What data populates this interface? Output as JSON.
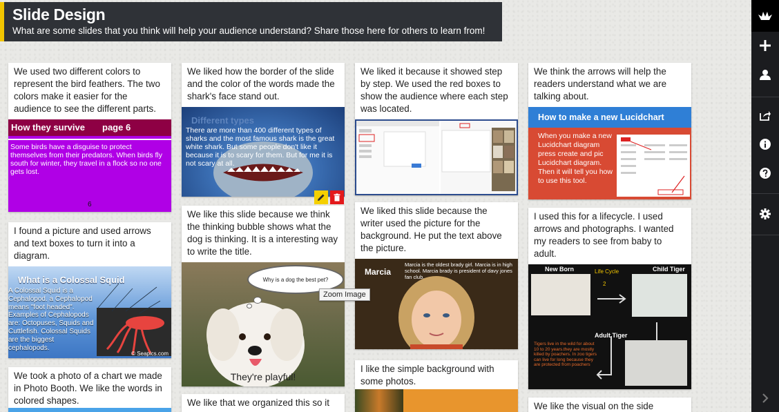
{
  "header": {
    "title": "Slide Design",
    "subtitle": "What are some slides that you think will help your audience understand? Share those here for others to learn from!"
  },
  "sidebar": {
    "icons": [
      "logo-bird-icon",
      "plus-icon",
      "user-icon",
      "share-icon",
      "info-icon",
      "help-icon",
      "gear-icon",
      "chevron-right-icon"
    ]
  },
  "tooltip": "Zoom Image",
  "colors": {
    "accent": "#f2c500",
    "header_bg": "#2f3237",
    "sidebar_bg": "#1b1c1f",
    "edit": "#f5d000",
    "delete": "#e3191b"
  },
  "cards": {
    "c1": {
      "text": "We used two different colors to represent the bird feathers. The two colors make it easier for the audience to see the different parts.",
      "slide_heading": "How they survive",
      "slide_page": "page 6",
      "slide_body": "Some birds have a disguise to protect themselves from their predators.  When birds fly south for winter, they travel in a flock so no one gets lost.",
      "slide_num": "6"
    },
    "c2": {
      "text": "I found a picture and used arrows and text boxes to turn it into a diagram.",
      "slide_heading": "What is a Colossal Squid",
      "slide_body": "A Colossal Squid is a Cephalopod. a Cephalopod means \"foot headed\". Examples of Cephalopods are: Octopuses, Squids and Cuttlefish. Colossal Squids are the biggest cephalopods.",
      "slide_credit": "© Seapics.com"
    },
    "c3": {
      "text": "We took a photo of a chart we made in Photo Booth.  We like the words in colored shapes."
    },
    "c4": {
      "text": "We liked how the border of the slide and the color of the words made the shark's face stand out.",
      "slide_heading": "Different types",
      "slide_body": "There are more than  400 different types of sharks and the most famous shark is the great white shark. But some people don't like it because it is to scary for them. But for me it is not scary at all."
    },
    "c5": {
      "text": "We like this slide because we think the thinking bubble shows what the dog is thinking. It is a interesting way to write the title.",
      "slide_bubble": "Why is a dog the best pet?",
      "slide_caption": "They're playful!"
    },
    "c6": {
      "text": "We like that we organized this so it"
    },
    "c7": {
      "text": "We liked it because it showed step by step. We used the red boxes to show the audience where each step was located."
    },
    "c8": {
      "text": "We liked this slide because the writer used the picture for the background. He put the text above the picture.",
      "slide_name": "Marcia",
      "slide_body": "Marcia is the oldest brady girl. Marcia is in high school. Marcia brady  is president of davy jones fan club."
    },
    "c9": {
      "text": "I like the simple background with some photos."
    },
    "c10": {
      "text": "We think the arrows will help the readers understand what we are talking about.",
      "slide_heading": "How to make a new Lucidchart",
      "slide_body": "When you make a new Lucidchart diagram press create and pic Lucidchart diagram. Then it will tell you how to use this tool."
    },
    "c11": {
      "text": "I used this for a lifecycle. I used arrows and photographs. I wanted my readers to see from baby to adult.",
      "label_newborn": "New Born",
      "label_lifecycle": "Life Cycle",
      "label_child": "Child Tiger",
      "label_adult": "Adult Tiger",
      "label_num": "2",
      "slide_body": "Tigers live in the wild for about 10 to 20 years.they are mostly killed by poachers. In zoo tigers can live for long because they are protected from poachers"
    },
    "c12": {
      "text": "We like the visual on the side"
    }
  }
}
